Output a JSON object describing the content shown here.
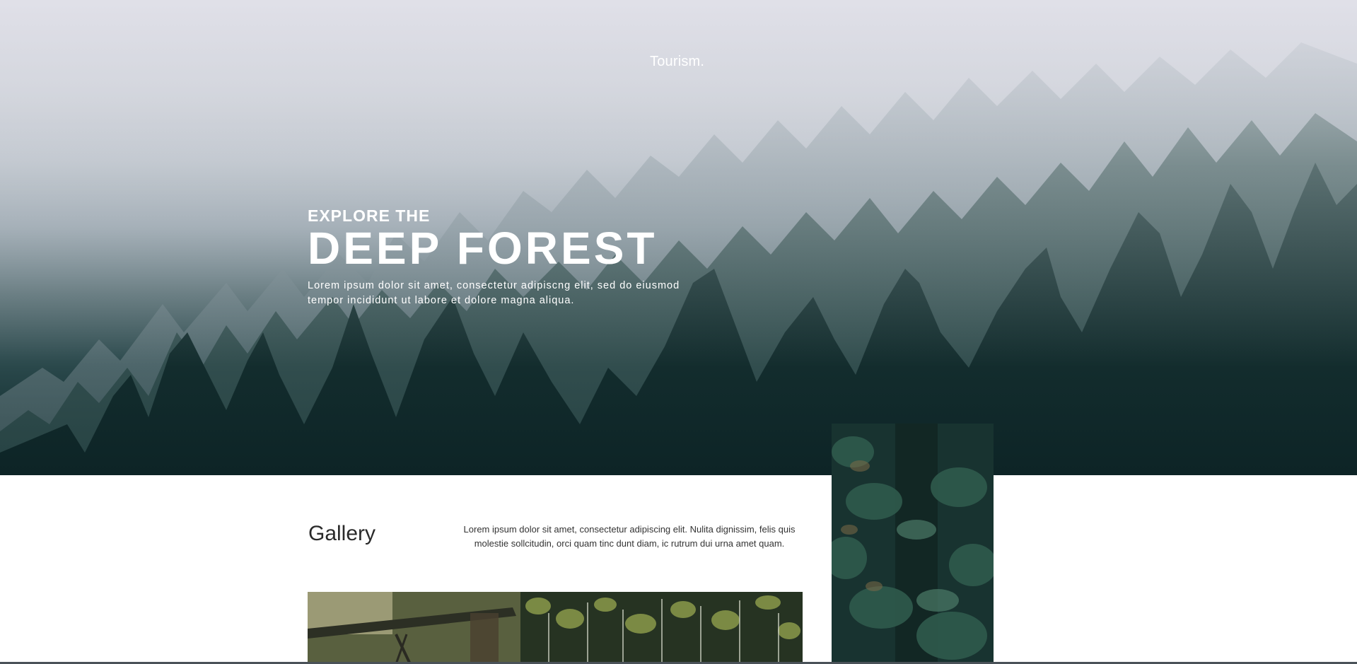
{
  "brand": {
    "logo_text": "Tourism."
  },
  "hero": {
    "kicker": "EXPLORE THE",
    "title": "DEEP FOREST",
    "description_line1": "Lorem ipsum dolor sit amet, consectetur adipiscng elit, sed do eiusmod",
    "description_line2": "tempor incididunt ut labore et dolore magna aliqua."
  },
  "gallery": {
    "title": "Gallery",
    "description_line1": "Lorem ipsum dolor sit amet, consectetur adipiscing elit. Nulita dignissim, felis quis",
    "description_line2": "molestie sollcitudin, orci quam tinc dunt diam, ic rutrum dui urna amet quam."
  },
  "colors": {
    "hero_fog": "#d6d6df",
    "forest_dark": "#0f2a2c",
    "text_light": "#ffffff",
    "text_dark": "#2a2a2a"
  }
}
